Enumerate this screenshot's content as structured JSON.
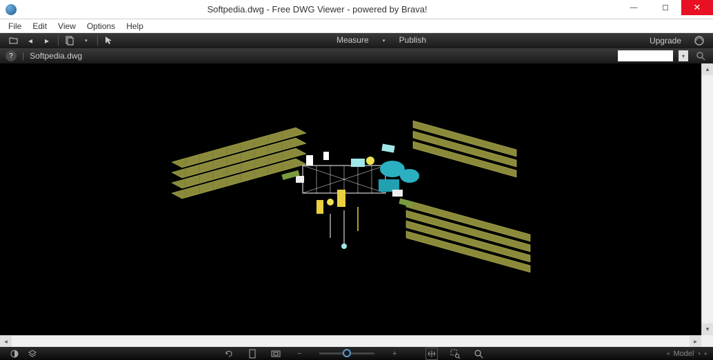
{
  "window": {
    "title": "Softpedia.dwg - Free DWG Viewer - powered by Brava!"
  },
  "menubar": {
    "items": [
      "File",
      "Edit",
      "View",
      "Options",
      "Help"
    ]
  },
  "toolbar1": {
    "measure": "Measure",
    "publish": "Publish",
    "upgrade": "Upgrade"
  },
  "toolbar2": {
    "filename": "Softpedia.dwg",
    "search_placeholder": ""
  },
  "statusbar": {
    "model": "Model"
  },
  "icons": {
    "open": "folder-open-icon",
    "back": "back-icon",
    "forward": "forward-icon",
    "pages": "pages-icon",
    "select": "cursor-icon",
    "info": "info-icon",
    "search": "search-icon",
    "brava": "brava-icon",
    "contrast": "contrast-icon",
    "layers": "layers-icon",
    "rotate": "rotate-icon",
    "page": "page-icon",
    "fit": "fit-icon",
    "zoom_out": "minus-icon",
    "zoom_in": "plus-icon",
    "pan": "pan-icon",
    "zoom_region": "zoom-region-icon",
    "magnify": "magnify-icon"
  }
}
